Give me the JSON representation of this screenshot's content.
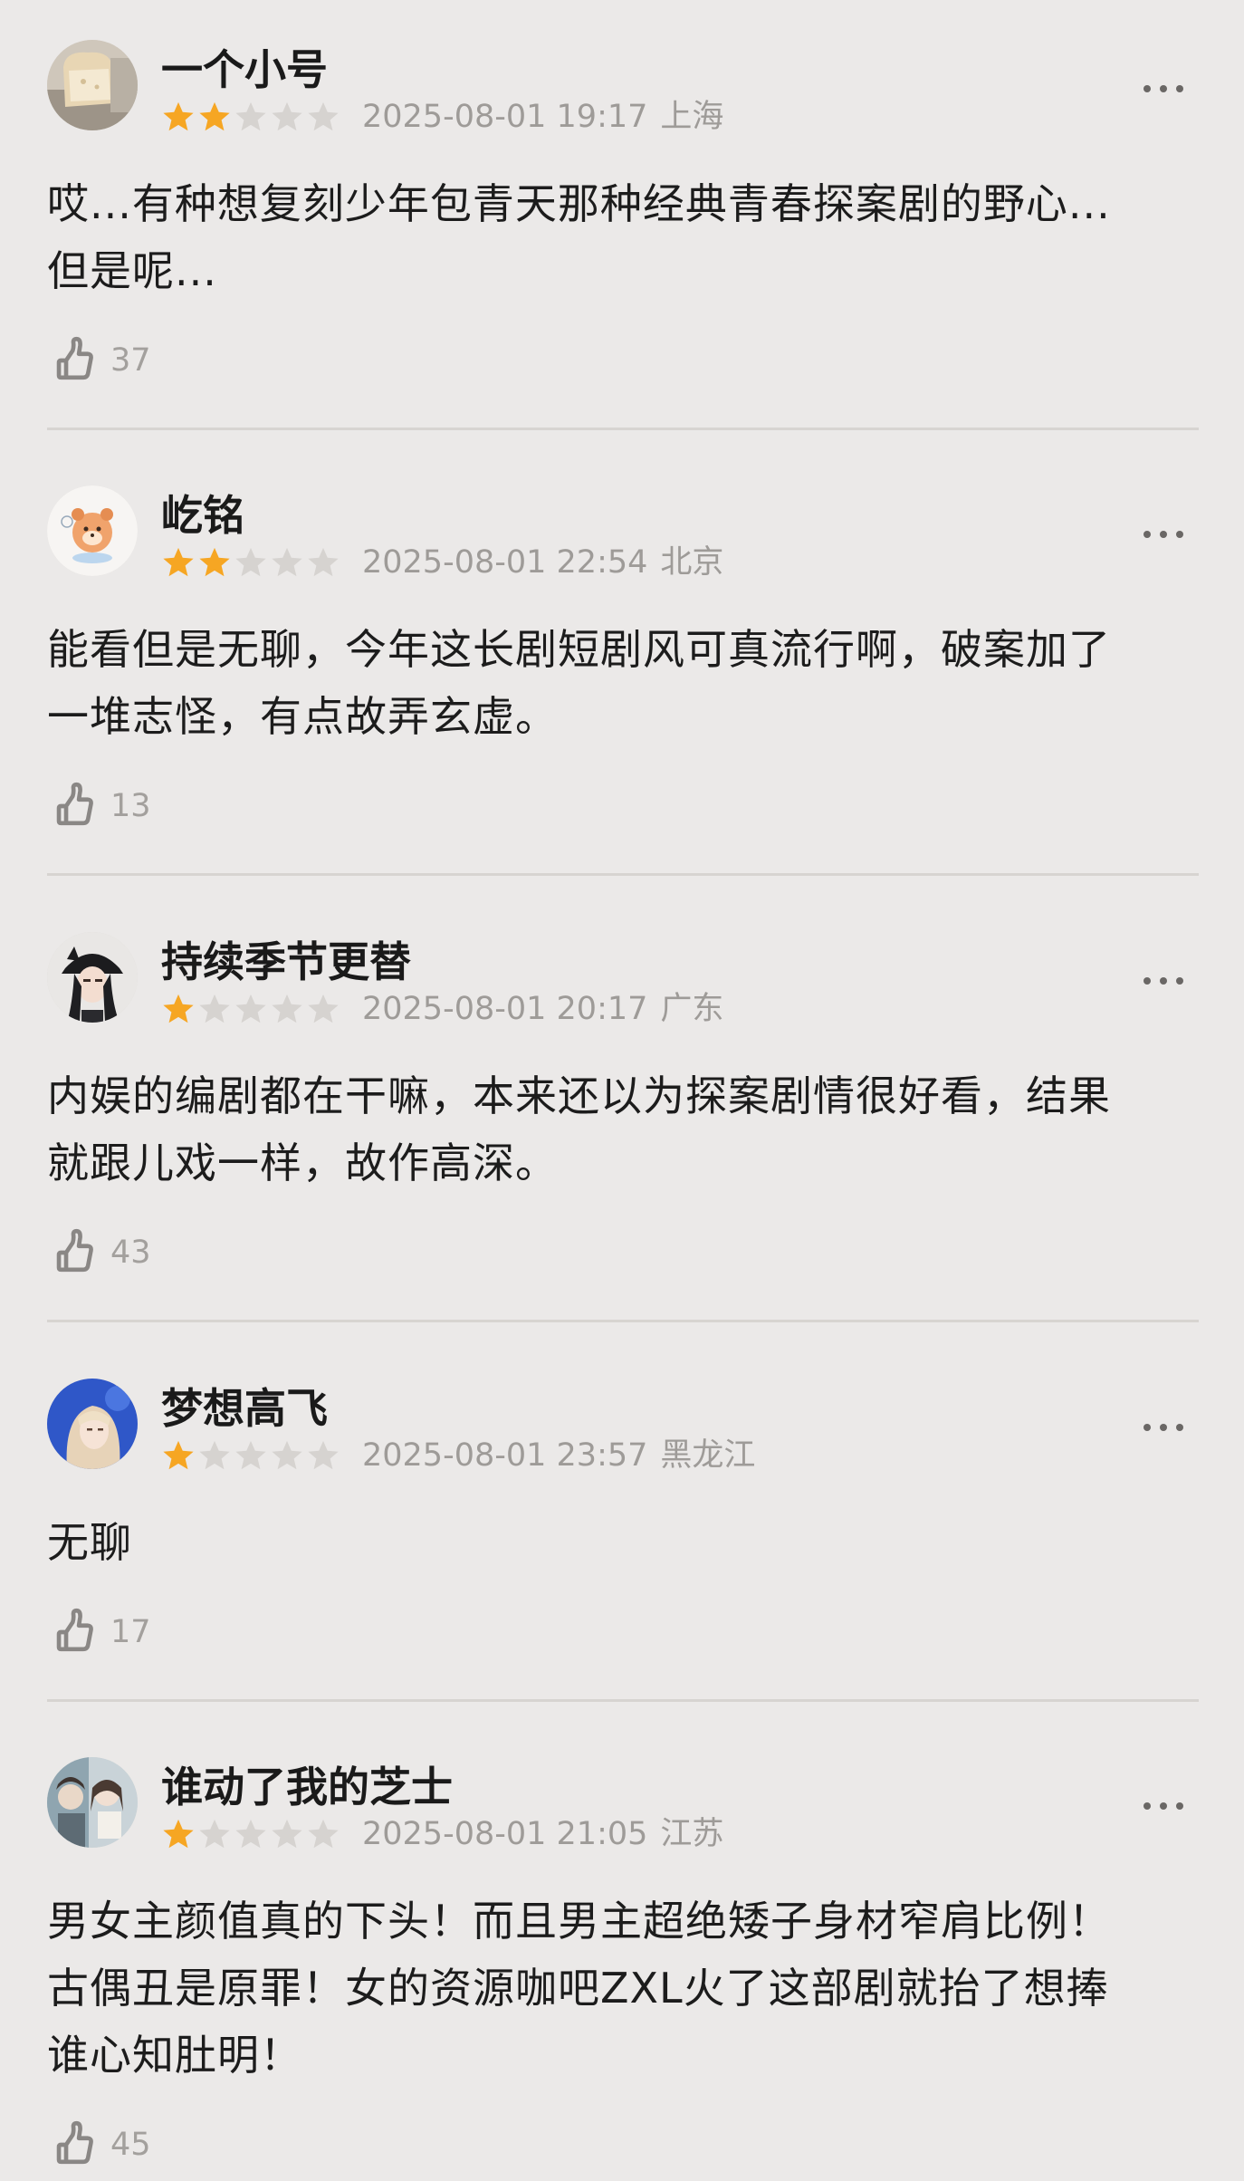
{
  "comments": [
    {
      "avatar_icon": "bread-photo-avatar",
      "username": "一个小号",
      "rating": 2,
      "max_rating": 5,
      "time": "2025-08-01 19:17",
      "location": "上海",
      "more_icon": "more-dots-icon",
      "text_lines": [
        "哎...有种想复刻少年包青天那种经典青春探案剧的野心...",
        "但是呢..."
      ],
      "like_icon": "thumbs-up-icon",
      "likes": "37"
    },
    {
      "avatar_icon": "cartoon-bear-avatar",
      "username": "屹铭",
      "rating": 2,
      "max_rating": 5,
      "time": "2025-08-01 22:54",
      "location": "北京",
      "more_icon": "more-dots-icon",
      "text_lines": [
        "能看但是无聊，今年这长剧短剧风可真流行啊，破案加了",
        "一堆志怪，有点故弄玄虚。"
      ],
      "like_icon": "thumbs-up-icon",
      "likes": "13"
    },
    {
      "avatar_icon": "girl-black-hat-avatar",
      "username": "持续季节更替",
      "rating": 1,
      "max_rating": 5,
      "time": "2025-08-01 20:17",
      "location": "广东",
      "more_icon": "more-dots-icon",
      "text_lines": [
        "内娱的编剧都在干嘛，本来还以为探案剧情很好看，结果",
        "就跟儿戏一样，故作高深。"
      ],
      "like_icon": "thumbs-up-icon",
      "likes": "43"
    },
    {
      "avatar_icon": "girl-blue-background-avatar",
      "username": "梦想高飞",
      "rating": 1,
      "max_rating": 5,
      "time": "2025-08-01 23:57",
      "location": "黑龙江",
      "more_icon": "more-dots-icon",
      "text_lines": [
        "无聊"
      ],
      "like_icon": "thumbs-up-icon",
      "likes": "17"
    },
    {
      "avatar_icon": "couple-photo-avatar",
      "username": "谁动了我的芝士",
      "rating": 1,
      "max_rating": 5,
      "time": "2025-08-01 21:05",
      "location": "江苏",
      "more_icon": "more-dots-icon",
      "text_lines": [
        "男女主颜值真的下头！而且男主超绝矮子身材窄肩比例！",
        "古偶丑是原罪！女的资源咖吧ZXL火了这部剧就抬了想捧",
        "谁心知肚明！"
      ],
      "like_icon": "thumbs-up-icon",
      "likes": "45"
    }
  ],
  "colors": {
    "background": "#ebe9e8",
    "star_on": "#f6a623",
    "star_off": "#d6d3d0",
    "meta_text": "#9e9b98",
    "divider": "#d7d4d1"
  }
}
